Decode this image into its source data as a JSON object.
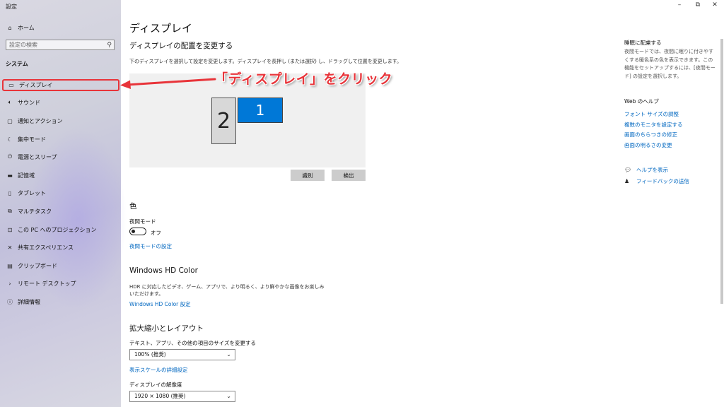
{
  "window": {
    "title": "設定",
    "minimize": "–",
    "maximize": "⧉",
    "close": "✕"
  },
  "sidebar": {
    "home": {
      "label": "ホーム",
      "icon": "home-icon"
    },
    "search": {
      "placeholder": "設定の検索"
    },
    "section": "システム",
    "items": [
      {
        "label": "ディスプレイ",
        "icon": "monitor-icon",
        "selected": true
      },
      {
        "label": "サウンド",
        "icon": "speaker-icon"
      },
      {
        "label": "通知とアクション",
        "icon": "notification-icon"
      },
      {
        "label": "集中モード",
        "icon": "moon-icon"
      },
      {
        "label": "電源とスリープ",
        "icon": "power-icon"
      },
      {
        "label": "記憶域",
        "icon": "storage-icon"
      },
      {
        "label": "タブレット",
        "icon": "tablet-icon"
      },
      {
        "label": "マルチタスク",
        "icon": "multitask-icon"
      },
      {
        "label": "この PC へのプロジェクション",
        "icon": "projection-icon"
      },
      {
        "label": "共有エクスペリエンス",
        "icon": "share-icon"
      },
      {
        "label": "クリップボード",
        "icon": "clipboard-icon"
      },
      {
        "label": "リモート デスクトップ",
        "icon": "remote-icon"
      },
      {
        "label": "詳細情報",
        "icon": "info-icon"
      }
    ]
  },
  "main": {
    "title": "ディスプレイ",
    "arrange": {
      "heading": "ディスプレイの配置を変更する",
      "description": "下のディスプレイを選択して設定を変更します。ディスプレイを長押し (または選択) し、ドラッグして位置を変更します。",
      "monitor1": "1",
      "monitor2": "2",
      "identify_button": "識別",
      "detect_button": "検出"
    },
    "color": {
      "heading": "色",
      "night_light_label": "夜間モード",
      "night_light_state": "オフ",
      "night_light_link": "夜間モードの設定"
    },
    "hdr": {
      "heading": "Windows HD Color",
      "description_line1": "HDR に対応したビデオ、ゲーム、アプリで、より明るく、より鮮やかな画像をお楽しみ",
      "description_line2": "いただけます。",
      "link": "Windows HD Color 設定"
    },
    "scale": {
      "heading": "拡大縮小とレイアウト",
      "scale_label": "テキスト、アプリ、その他の項目のサイズを変更する",
      "scale_value": "100% (推奨)",
      "advanced_link": "表示スケールの詳細設定",
      "resolution_label": "ディスプレイの解像度",
      "resolution_value": "1920 × 1080 (推奨)"
    }
  },
  "right_panel": {
    "sleep_title": "睡眠に配慮する",
    "sleep_text": "夜間モードでは、夜間に眠りに付きやすくする暖色系の色を表示できます。この機能をセットアップするには、[夜間モード] の設定を選択します。",
    "web_help_title": "Web のヘルプ",
    "links": [
      "フォント サイズの調整",
      "複数のモニタを設定する",
      "画面のちらつきの修正",
      "画面の明るさの変更"
    ],
    "get_help": "ヘルプを表示",
    "feedback": "フィードバックの送信"
  },
  "annotation": {
    "text": "「ディスプレイ」をクリック",
    "color": "#e8343a"
  },
  "colors": {
    "accent": "#0067c0",
    "monitor_selected": "#0078d7"
  }
}
